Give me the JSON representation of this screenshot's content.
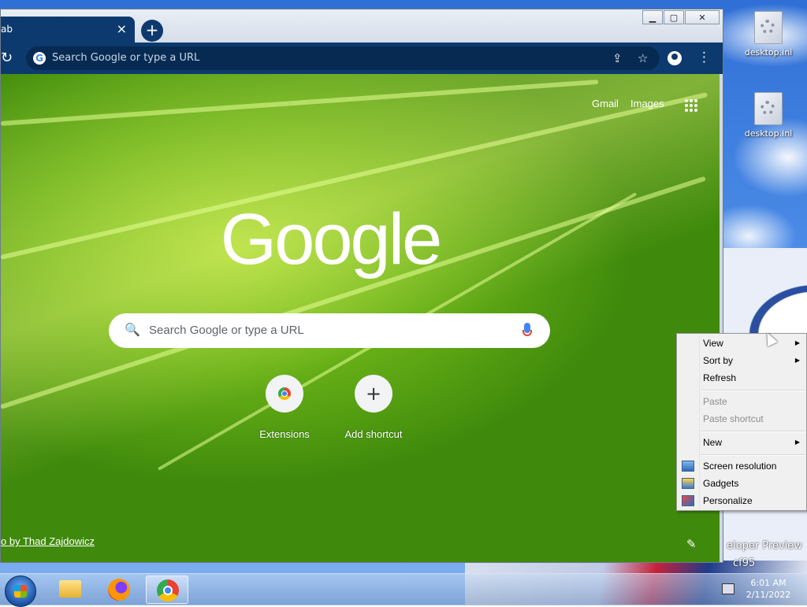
{
  "desktop": {
    "icons": [
      {
        "label": "desktop.ini"
      },
      {
        "label": "desktop.ini"
      }
    ],
    "wallpaper_texts": [
      "eloper Preview",
      "cf95"
    ]
  },
  "browser": {
    "tab_title": "ab",
    "tab_close": "×",
    "new_tab": "+",
    "window_controls": {
      "minimize": "▁",
      "maximize": "▢",
      "close": "✕"
    },
    "reload": "↻",
    "omnibox_placeholder": "Search Google or type a URL",
    "toolbar_icons": [
      "share-icon",
      "star-icon",
      "profile-icon",
      "menu-icon"
    ],
    "toolbar_glyphs": {
      "share": "⇪",
      "star": "☆",
      "menu": "⋮"
    },
    "accent_color": "#0d3a6e"
  },
  "ntp": {
    "links": {
      "gmail": "Gmail",
      "images": "Images"
    },
    "logo": "Google",
    "search_placeholder": "Search Google or type a URL",
    "shortcuts": [
      {
        "label": "Extensions"
      },
      {
        "label": "Add shortcut",
        "glyph": "+"
      }
    ],
    "photo_credit": "o by Thad Zajdowicz"
  },
  "context_menu": {
    "items": [
      {
        "label": "View",
        "submenu": true,
        "disabled": false
      },
      {
        "label": "Sort by",
        "submenu": true,
        "disabled": false
      },
      {
        "label": "Refresh",
        "submenu": false,
        "disabled": false
      },
      {
        "label": "Paste",
        "submenu": false,
        "disabled": true
      },
      {
        "label": "Paste shortcut",
        "submenu": false,
        "disabled": true
      },
      {
        "label": "New",
        "submenu": true,
        "disabled": false
      },
      {
        "label": "Screen resolution",
        "submenu": false,
        "disabled": false
      },
      {
        "label": "Gadgets",
        "submenu": false,
        "disabled": false
      },
      {
        "label": "Personalize",
        "submenu": false,
        "disabled": false
      }
    ],
    "submenu_arrow": "▶"
  },
  "taskbar": {
    "apps": [
      "file-explorer-icon",
      "firefox-icon",
      "chrome-icon"
    ],
    "clock": {
      "time": "6:01 AM",
      "date": "2/11/2022"
    }
  }
}
